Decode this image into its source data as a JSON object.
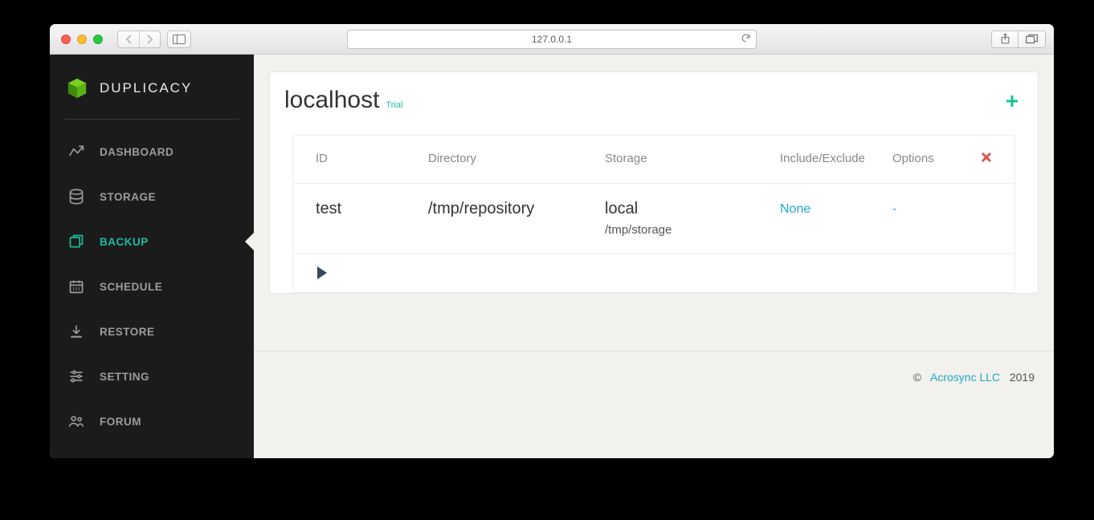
{
  "browser": {
    "url_display": "127.0.0.1"
  },
  "brand": {
    "name": "DUPLICACY"
  },
  "sidebar": {
    "items": [
      {
        "label": "DASHBOARD"
      },
      {
        "label": "STORAGE"
      },
      {
        "label": "BACKUP"
      },
      {
        "label": "SCHEDULE"
      },
      {
        "label": "RESTORE"
      },
      {
        "label": "SETTING"
      },
      {
        "label": "FORUM"
      }
    ],
    "active_index": 2
  },
  "panel": {
    "title": "localhost",
    "license_tag": "Trial",
    "columns": {
      "id": "ID",
      "directory": "Directory",
      "storage": "Storage",
      "include_exclude": "Include/Exclude",
      "options": "Options"
    },
    "rows": [
      {
        "id": "test",
        "directory": "/tmp/repository",
        "storage_name": "local",
        "storage_path": "/tmp/storage",
        "include_exclude": "None",
        "options": "-"
      }
    ]
  },
  "footer": {
    "copyright_symbol": "©",
    "company": "Acrosync LLC",
    "year": "2019"
  }
}
